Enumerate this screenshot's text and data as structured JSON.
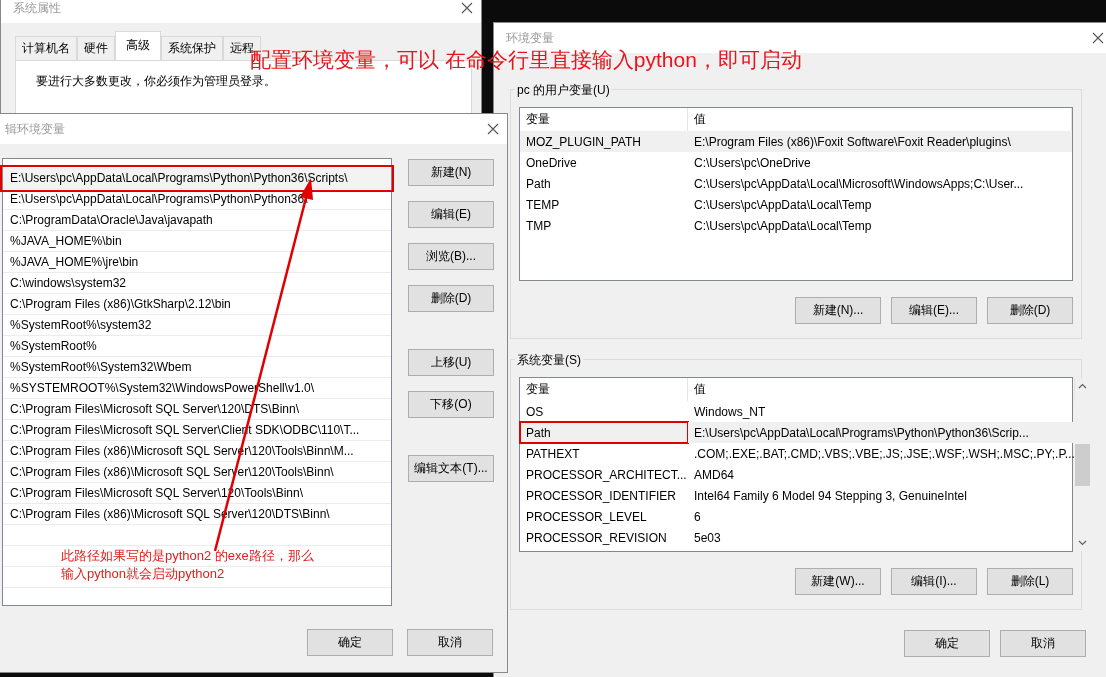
{
  "system_properties": {
    "title": "系统属性",
    "tabs": [
      {
        "label": "计算机名",
        "selected": false
      },
      {
        "label": "硬件",
        "selected": false
      },
      {
        "label": "高级",
        "selected": true
      },
      {
        "label": "系统保护",
        "selected": false
      },
      {
        "label": "远程",
        "selected": false
      }
    ],
    "message": "要进行大多数更改，你必须作为管理员登录。"
  },
  "headline": "配置环境变量，可以 在命令行里直接输入python，即可启动",
  "edit_dialog": {
    "title": "辑环境变量",
    "items": [
      {
        "text": "E:\\Users\\pc\\AppData\\Local\\Programs\\Python\\Python36\\Scripts\\",
        "selected": true,
        "circled": true
      },
      {
        "text": "E:\\Users\\pc\\AppData\\Local\\Programs\\Python\\Python36\\",
        "selected": false,
        "circled": false
      },
      {
        "text": "C:\\ProgramData\\Oracle\\Java\\javapath",
        "selected": false,
        "circled": false
      },
      {
        "text": "%JAVA_HOME%\\bin",
        "selected": false,
        "circled": false
      },
      {
        "text": "%JAVA_HOME%\\jre\\bin",
        "selected": false,
        "circled": false
      },
      {
        "text": "C:\\windows\\system32",
        "selected": false,
        "circled": false
      },
      {
        "text": "C:\\Program Files (x86)\\GtkSharp\\2.12\\bin",
        "selected": false,
        "circled": false
      },
      {
        "text": "%SystemRoot%\\system32",
        "selected": false,
        "circled": false
      },
      {
        "text": "%SystemRoot%",
        "selected": false,
        "circled": false
      },
      {
        "text": "%SystemRoot%\\System32\\Wbem",
        "selected": false,
        "circled": false
      },
      {
        "text": "%SYSTEMROOT%\\System32\\WindowsPowerShell\\v1.0\\",
        "selected": false,
        "circled": false
      },
      {
        "text": "C:\\Program Files\\Microsoft SQL Server\\120\\DTS\\Binn\\",
        "selected": false,
        "circled": false
      },
      {
        "text": "C:\\Program Files\\Microsoft SQL Server\\Client SDK\\ODBC\\110\\T...",
        "selected": false,
        "circled": false
      },
      {
        "text": "C:\\Program Files (x86)\\Microsoft SQL Server\\120\\Tools\\Binn\\M...",
        "selected": false,
        "circled": false
      },
      {
        "text": "C:\\Program Files (x86)\\Microsoft SQL Server\\120\\Tools\\Binn\\",
        "selected": false,
        "circled": false
      },
      {
        "text": "C:\\Program Files\\Microsoft SQL Server\\120\\Tools\\Binn\\",
        "selected": false,
        "circled": false
      },
      {
        "text": "C:\\Program Files (x86)\\Microsoft SQL Server\\120\\DTS\\Binn\\",
        "selected": false,
        "circled": false
      }
    ],
    "button_groups": [
      [
        "新建(N)",
        "编辑(E)",
        "浏览(B)...",
        "删除(D)"
      ],
      [
        "上移(U)",
        "下移(O)"
      ],
      [
        "编辑文本(T)..."
      ]
    ],
    "note_lines": [
      "此路径如果写的是python2 的exe路径，那么",
      "输入python就会启动python2"
    ],
    "footer_buttons": [
      "确定",
      "取消"
    ]
  },
  "env_dialog": {
    "title": "环境变量",
    "user_group": {
      "label": "pc 的用户变量(U)",
      "columns": [
        "变量",
        "值"
      ],
      "rows": [
        {
          "cells": [
            "MOZ_PLUGIN_PATH",
            "E:\\Program Files (x86)\\Foxit Software\\Foxit Reader\\plugins\\"
          ],
          "selected": true,
          "circled": false
        },
        {
          "cells": [
            "OneDrive",
            "C:\\Users\\pc\\OneDrive"
          ],
          "selected": false,
          "circled": false
        },
        {
          "cells": [
            "Path",
            "C:\\Users\\pc\\AppData\\Local\\Microsoft\\WindowsApps;C:\\User..."
          ],
          "selected": false,
          "circled": false
        },
        {
          "cells": [
            "TEMP",
            "C:\\Users\\pc\\AppData\\Local\\Temp"
          ],
          "selected": false,
          "circled": false
        },
        {
          "cells": [
            "TMP",
            "C:\\Users\\pc\\AppData\\Local\\Temp"
          ],
          "selected": false,
          "circled": false
        }
      ],
      "buttons": [
        "新建(N)...",
        "编辑(E)...",
        "删除(D)"
      ]
    },
    "system_group": {
      "label": "系统变量(S)",
      "columns": [
        "变量",
        "值"
      ],
      "rows": [
        {
          "cells": [
            "OS",
            "Windows_NT"
          ],
          "selected": false,
          "circled": false
        },
        {
          "cells": [
            "Path",
            "E:\\Users\\pc\\AppData\\Local\\Programs\\Python\\Python36\\Scrip..."
          ],
          "selected": true,
          "circled": true
        },
        {
          "cells": [
            "PATHEXT",
            ".COM;.EXE;.BAT;.CMD;.VBS;.VBE;.JS;.JSE;.WSF;.WSH;.MSC;.PY;.P..."
          ],
          "selected": false,
          "circled": false
        },
        {
          "cells": [
            "PROCESSOR_ARCHITECT...",
            "AMD64"
          ],
          "selected": false,
          "circled": false
        },
        {
          "cells": [
            "PROCESSOR_IDENTIFIER",
            "Intel64 Family 6 Model 94 Stepping 3, GenuineIntel"
          ],
          "selected": false,
          "circled": false
        },
        {
          "cells": [
            "PROCESSOR_LEVEL",
            "6"
          ],
          "selected": false,
          "circled": false
        },
        {
          "cells": [
            "PROCESSOR_REVISION",
            "5e03"
          ],
          "selected": false,
          "circled": false
        }
      ],
      "buttons": [
        "新建(W)...",
        "编辑(I)...",
        "删除(L)"
      ]
    },
    "footer_buttons": [
      "确定",
      "取消"
    ]
  }
}
